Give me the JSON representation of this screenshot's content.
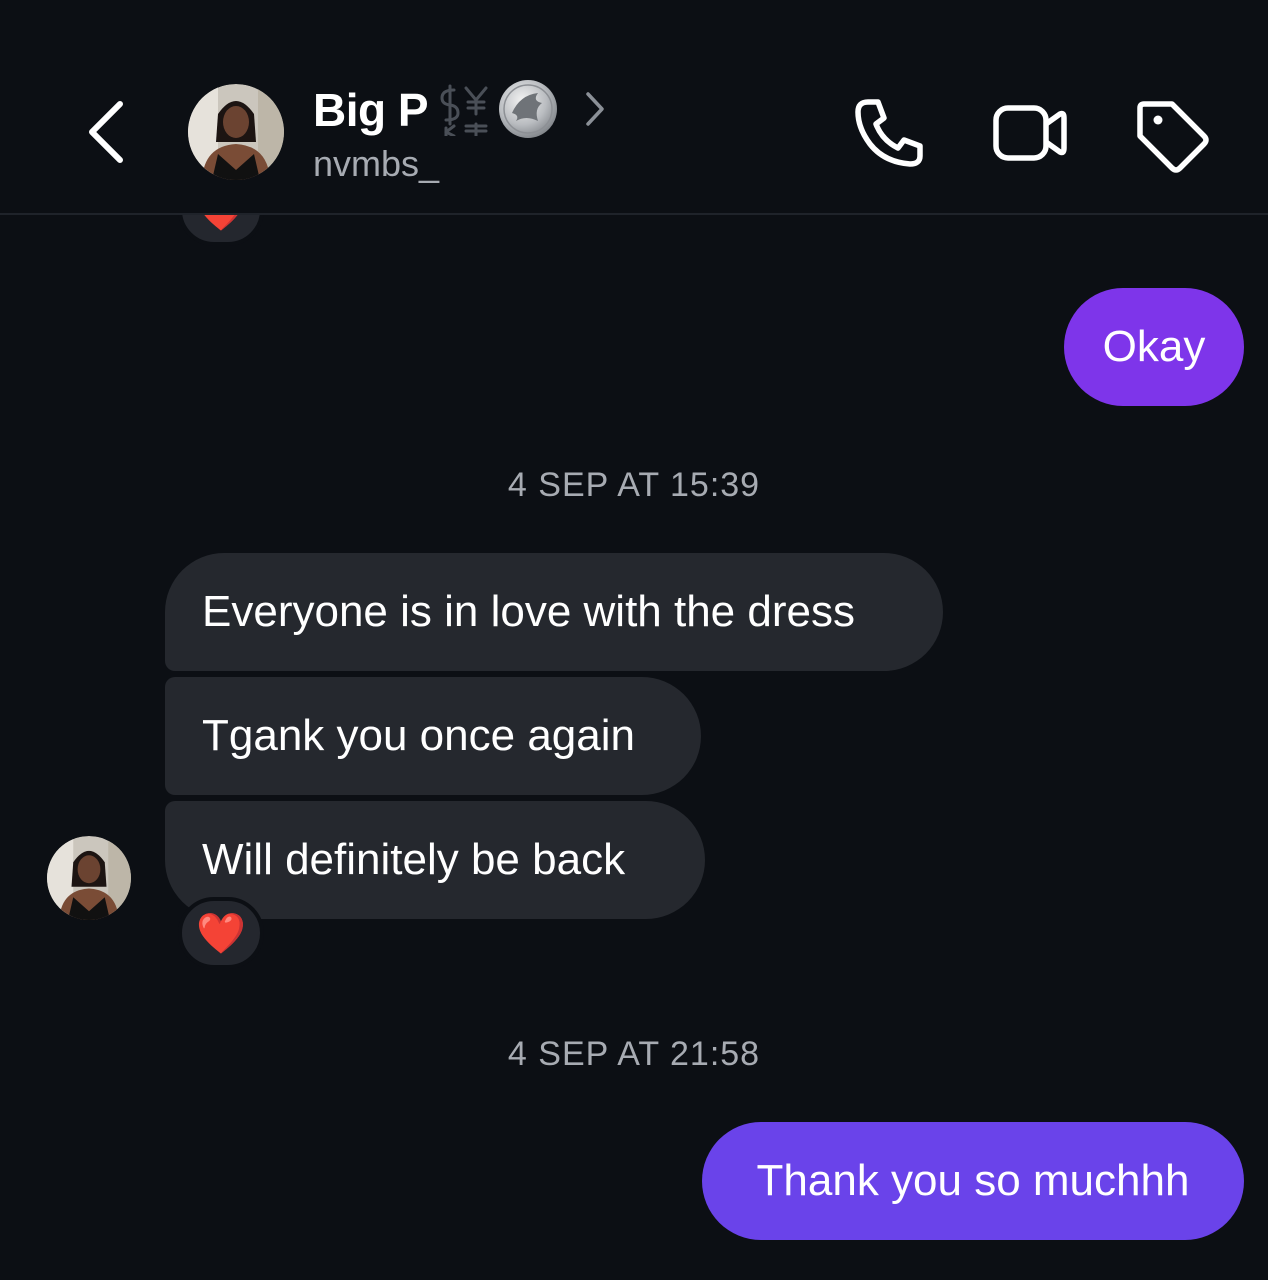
{
  "header": {
    "contact_name": "Big P",
    "username": "nvmbs_"
  },
  "conversation": {
    "timestamps": [
      "4 SEP AT 15:39",
      "4 SEP AT 21:58"
    ],
    "messages": [
      {
        "direction": "outgoing",
        "text": "Okay"
      },
      {
        "direction": "incoming",
        "text": "Everyone is in love with the dress"
      },
      {
        "direction": "incoming",
        "text": "Tgank you once again"
      },
      {
        "direction": "incoming",
        "text": "Will definitely be back",
        "reaction": "❤️"
      },
      {
        "direction": "outgoing",
        "text": "Thank you so muchhh"
      }
    ],
    "earlier_reaction": "❤️"
  },
  "colors": {
    "background": "#0c0f14",
    "incoming_bubble": "#25282e",
    "outgoing_bubble_1": "#7e35ea",
    "outgoing_bubble_2": "#6a43ea",
    "secondary_text": "#a7abb2"
  },
  "icons": [
    "back-chevron-icon",
    "money-currency-icon",
    "silver-coin-icon",
    "chevron-right-icon",
    "phone-icon",
    "video-camera-icon",
    "tag-icon"
  ]
}
